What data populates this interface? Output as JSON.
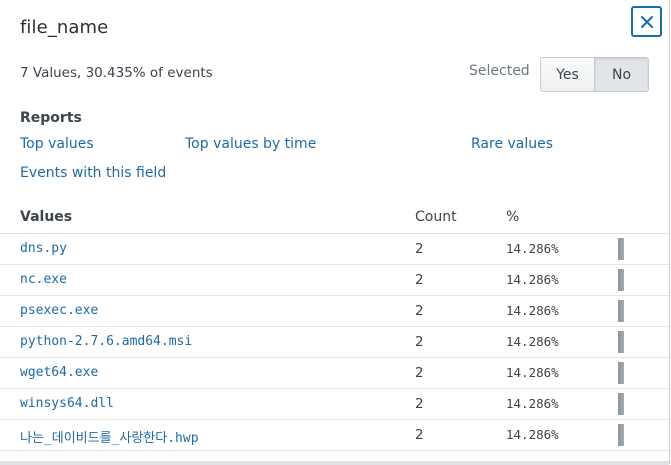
{
  "panel": {
    "title": "file_name",
    "summary": "7 Values, 30.435% of events",
    "selected_label": "Selected",
    "toggle": {
      "yes": "Yes",
      "no": "No",
      "active": "No"
    },
    "close_icon": "close-icon",
    "accent_color": "#1e6aa3"
  },
  "reports": {
    "heading": "Reports",
    "links": {
      "top_values": "Top values",
      "top_values_by_time": "Top values by time",
      "rare_values": "Rare values",
      "events_with_field": "Events with this field"
    }
  },
  "table": {
    "headers": {
      "values": "Values",
      "count": "Count",
      "percent": "%"
    },
    "rows": [
      {
        "value": "dns.py",
        "count": "2",
        "percent": "14.286%",
        "fraction": 0.14286
      },
      {
        "value": "nc.exe",
        "count": "2",
        "percent": "14.286%",
        "fraction": 0.14286
      },
      {
        "value": "psexec.exe",
        "count": "2",
        "percent": "14.286%",
        "fraction": 0.14286
      },
      {
        "value": "python-2.7.6.amd64.msi",
        "count": "2",
        "percent": "14.286%",
        "fraction": 0.14286
      },
      {
        "value": "wget64.exe",
        "count": "2",
        "percent": "14.286%",
        "fraction": 0.14286
      },
      {
        "value": "winsys64.dll",
        "count": "2",
        "percent": "14.286%",
        "fraction": 0.14286
      },
      {
        "value": "나는_데이비드를_사랑한다.hwp",
        "count": "2",
        "percent": "14.286%",
        "fraction": 0.14286
      }
    ]
  }
}
